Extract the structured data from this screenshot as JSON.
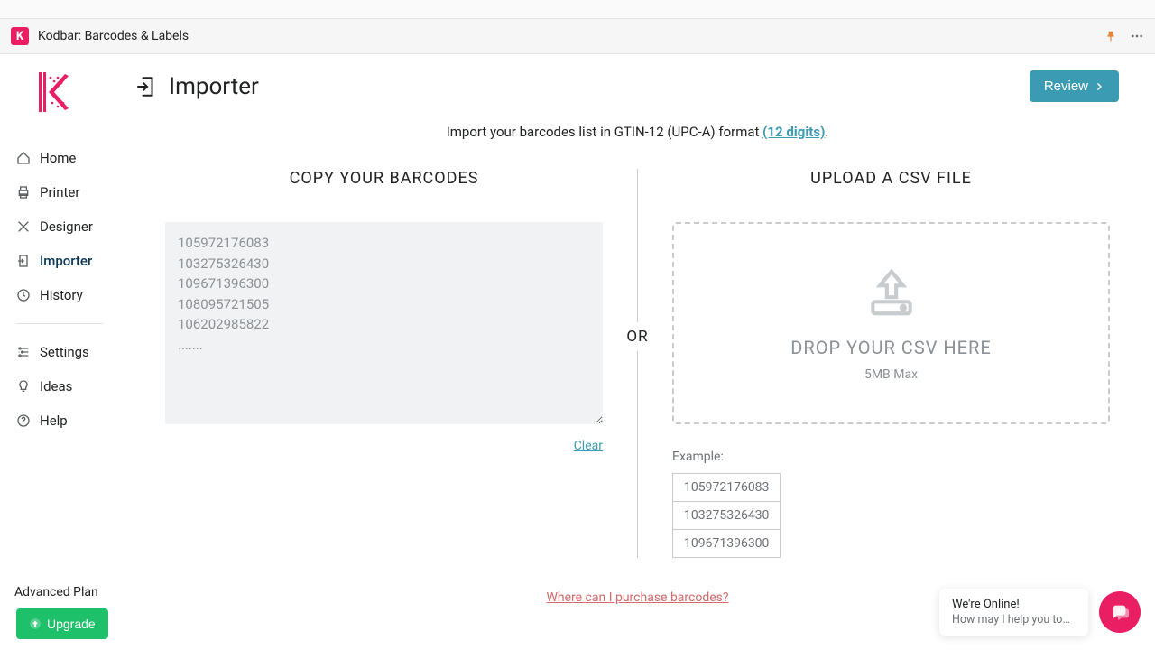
{
  "app": {
    "title": "Kodbar: Barcodes & Labels"
  },
  "page": {
    "title": "Importer",
    "review_label": "Review",
    "instruction_prefix": "Import your barcodes list in GTIN-12 (UPC-A) format ",
    "instruction_digits": "(12 digits)",
    "instruction_suffix": "."
  },
  "sidebar": {
    "items": [
      {
        "label": "Home"
      },
      {
        "label": "Printer"
      },
      {
        "label": "Designer"
      },
      {
        "label": "Importer"
      },
      {
        "label": "History"
      }
    ],
    "items2": [
      {
        "label": "Settings"
      },
      {
        "label": "Ideas"
      },
      {
        "label": "Help"
      }
    ],
    "plan": "Advanced Plan",
    "upgrade": "Upgrade"
  },
  "left": {
    "heading": "COPY YOUR BARCODES",
    "placeholder": "105972176083\n103275326430\n109671396300\n108095721505\n106202985822\n.......",
    "clear": "Clear"
  },
  "center": {
    "or": "OR"
  },
  "right": {
    "heading": "UPLOAD A CSV FILE",
    "drop_title": "DROP YOUR CSV HERE",
    "drop_sub": "5MB Max",
    "example_label": "Example:",
    "examples": [
      "105972176083",
      "103275326430",
      "109671396300"
    ]
  },
  "footer": {
    "purchase": "Where can I purchase barcodes?"
  },
  "chat": {
    "title": "We're Online!",
    "sub": "How may I help you toda..."
  }
}
